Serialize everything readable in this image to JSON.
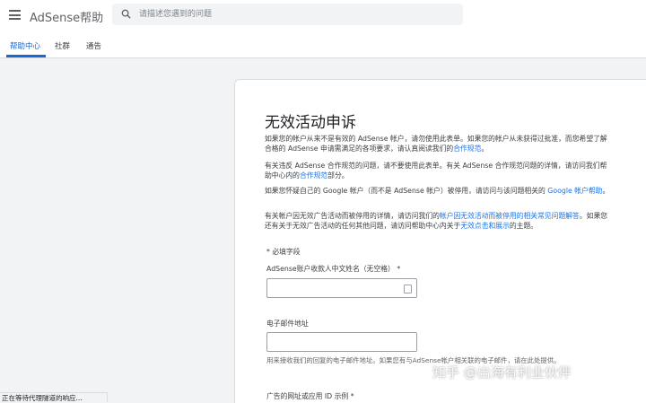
{
  "app": {
    "title": "AdSense帮助"
  },
  "search": {
    "placeholder": "请描述您遇到的问题"
  },
  "tabs": [
    {
      "label": "帮助中心",
      "active": true
    },
    {
      "label": "社群",
      "active": false
    },
    {
      "label": "通告",
      "active": false
    }
  ],
  "page": {
    "title": "无效活动申诉",
    "para1": "如果您的帐户从来不是有效的 AdSense 帐户，请勿使用此表单。如果您的帐户从未获得过批准，而您希望了解合格的 AdSense 申请需满足的各项要求，请认真阅读我们的",
    "para1_link": "合作规范",
    "para1_end": "。",
    "para2": "有关违反 AdSense 合作规范的问题，请不要使用此表单。有关 AdSense 合作规范问题的详情，请访问我们帮助中心内的",
    "para2_link": "合作规范",
    "para2_end": "部分。",
    "para3": "如果您怀疑自己的 Google 帐户（而不是 AdSense 帐户）被停用，请访问与该问题相关的 ",
    "para3_link": "Google 帐户帮助",
    "para3_end": "。",
    "para4": "有关帐户因无效广告活动而被停用的详情，请访问我们的",
    "para4_link1": "帐户因无效活动而被停用的相关常见问题解答",
    "para4_mid": "。如果您还有关于无效广告活动的任何其他问题，请访问帮助中心内关于",
    "para4_link2": "无效点击和展示",
    "para4_end": "的主题。",
    "required_note": "* 必填字段",
    "name_label": "AdSense账户收款人中文姓名（无空格） *",
    "email_label": "电子邮件地址",
    "email_help": "用来接收我们的回复的电子邮件地址。如果您有与AdSense帐户相关联的电子邮件，请在此处提供。",
    "url_label": "广告的网址或应用 ID 示例 *"
  },
  "status": {
    "text": "正在等待代理隧道的响应..."
  },
  "watermark": {
    "text": "知乎 @出海有利业伙伴"
  },
  "colors": {
    "accent": "#1967d2",
    "link": "#1a73e8",
    "background": "#f1f3f4"
  }
}
